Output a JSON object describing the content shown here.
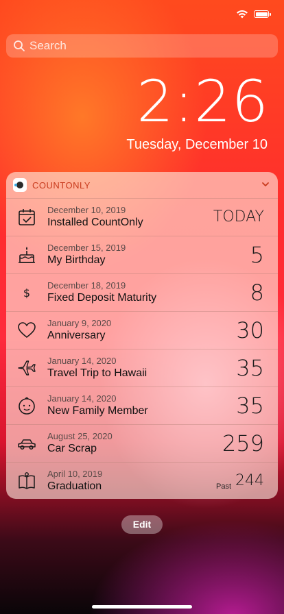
{
  "search": {
    "placeholder": "Search"
  },
  "lockscreen": {
    "time": "2:26",
    "date": "Tuesday, December 10"
  },
  "widget": {
    "app_name": "COUNTONLY",
    "items": [
      {
        "date": "December 10, 2019",
        "title": "Installed CountOnly",
        "value": "TODAY",
        "icon": "calendar-check-icon"
      },
      {
        "date": "December 15, 2019",
        "title": "My Birthday",
        "value": "5",
        "icon": "birthday-cake-icon"
      },
      {
        "date": "December 18, 2019",
        "title": "Fixed Deposit Maturity",
        "value": "8",
        "icon": "dollar-icon"
      },
      {
        "date": "January 9, 2020",
        "title": "Anniversary",
        "value": "30",
        "icon": "heart-icon"
      },
      {
        "date": "January 14, 2020",
        "title": "Travel Trip to Hawaii",
        "value": "35",
        "icon": "airplane-icon"
      },
      {
        "date": "January 14, 2020",
        "title": "New Family Member",
        "value": "35",
        "icon": "baby-face-icon"
      },
      {
        "date": "August 25, 2020",
        "title": "Car Scrap",
        "value": "259",
        "icon": "car-icon"
      },
      {
        "date": "April 10, 2019",
        "title": "Graduation",
        "value": "244",
        "prefix": "Past",
        "icon": "book-icon"
      }
    ]
  },
  "edit_label": "Edit"
}
